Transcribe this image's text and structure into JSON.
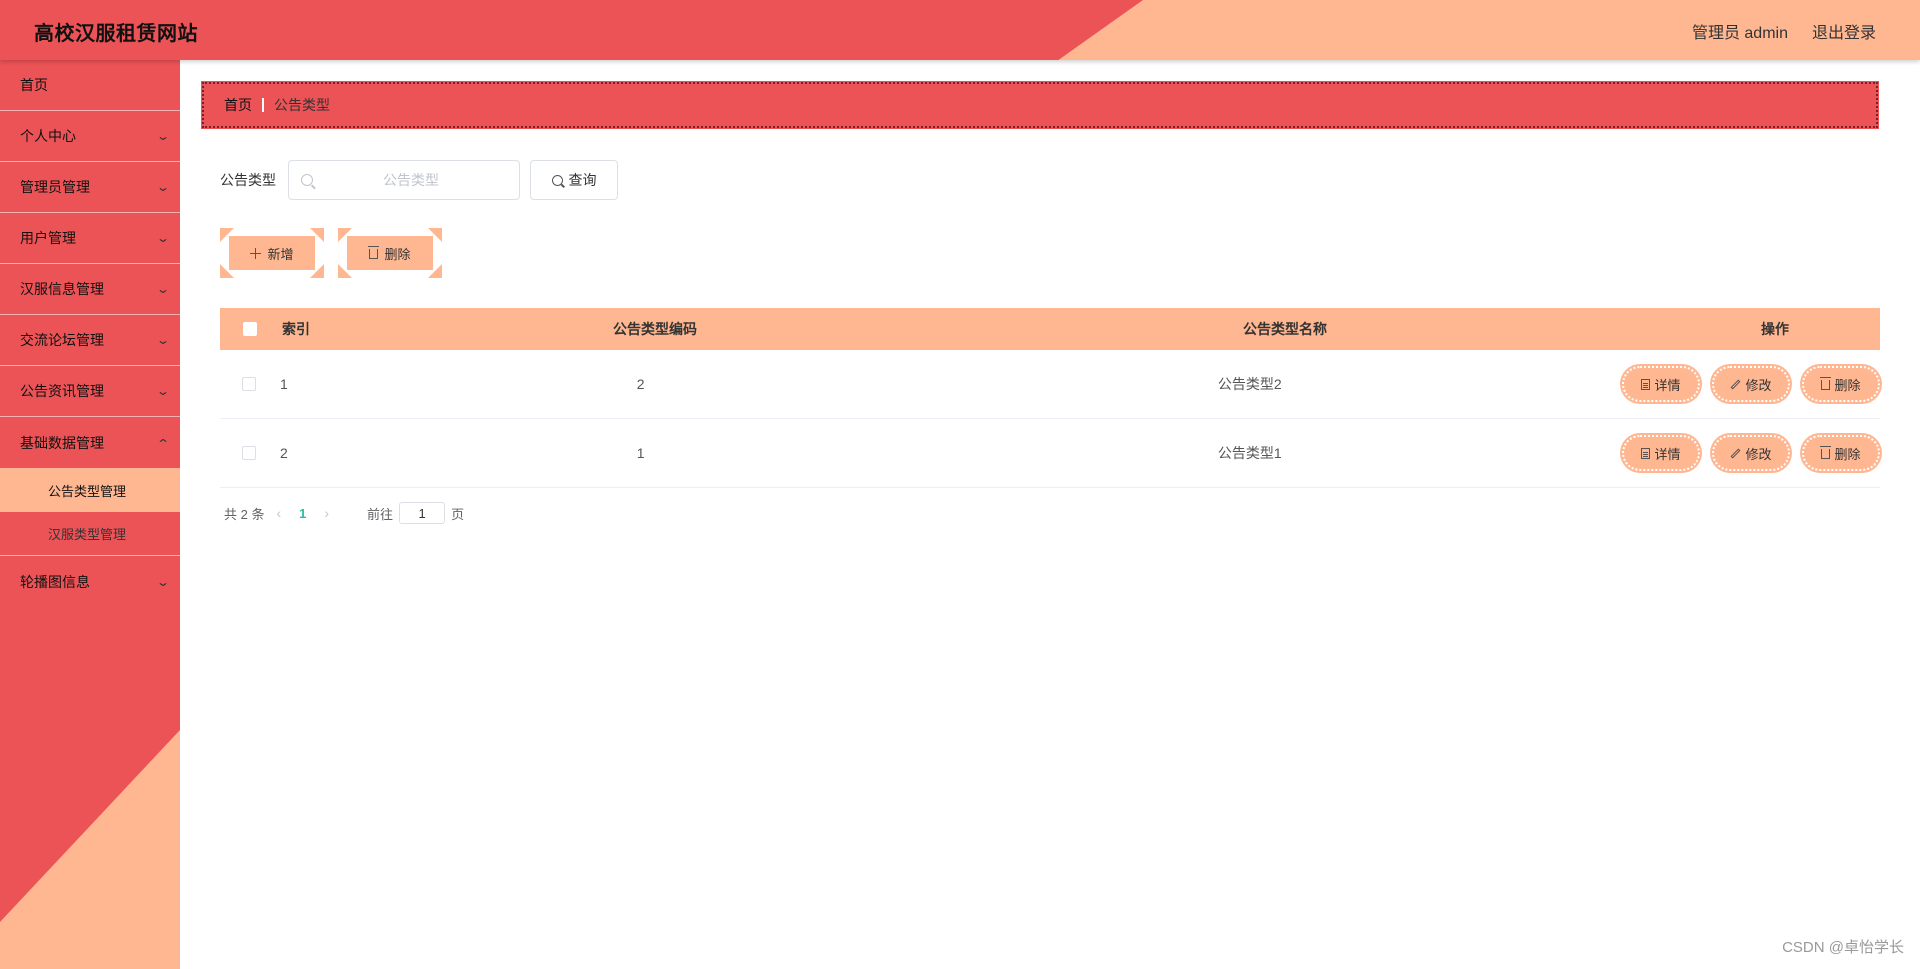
{
  "header": {
    "title": "高校汉服租赁网站",
    "user": "管理员 admin",
    "logout": "退出登录"
  },
  "colors": {
    "primary": "#eb5356",
    "accent": "#ffb792",
    "page_active": "#27c0a0"
  },
  "sidebar": {
    "items": [
      {
        "label": "首页"
      },
      {
        "label": "个人中心"
      },
      {
        "label": "管理员管理"
      },
      {
        "label": "用户管理"
      },
      {
        "label": "汉服信息管理"
      },
      {
        "label": "交流论坛管理"
      },
      {
        "label": "公告资讯管理"
      },
      {
        "label": "基础数据管理"
      },
      {
        "label": "轮播图信息"
      }
    ],
    "sub_items": [
      {
        "label": "公告类型管理",
        "active": true
      },
      {
        "label": "汉服类型管理",
        "active": false
      }
    ]
  },
  "breadcrumb": {
    "home": "首页",
    "current": "公告类型"
  },
  "search": {
    "label": "公告类型",
    "placeholder": "公告类型",
    "query_button": "查询"
  },
  "actions": {
    "add": "新增",
    "delete": "删除"
  },
  "table": {
    "headers": [
      "索引",
      "公告类型编码",
      "公告类型名称",
      "操作"
    ],
    "rows": [
      {
        "index": "1",
        "code": "2",
        "name": "公告类型2"
      },
      {
        "index": "2",
        "code": "1",
        "name": "公告类型1"
      }
    ],
    "ops": {
      "detail": "详情",
      "edit": "修改",
      "delete": "删除"
    }
  },
  "pagination": {
    "total": "共 2 条",
    "current_page": "1",
    "goto_label": "前往",
    "goto_value": "1",
    "page_suffix": "页"
  },
  "watermark": "CSDN @卓怡学长"
}
